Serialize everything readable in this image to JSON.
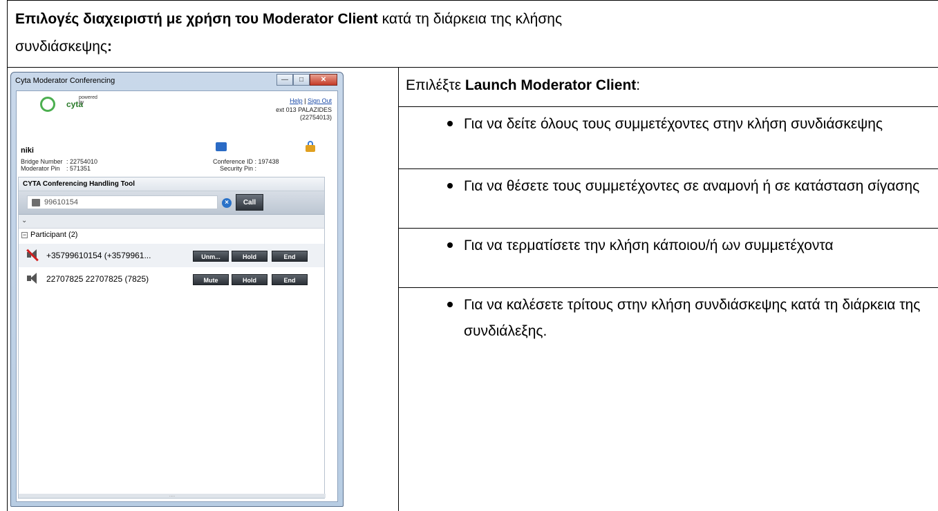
{
  "doc": {
    "header_bold": "Επιλογές διαχειριστή με χρήση του Moderator Client",
    "header_rest": " κατά τη διάρκεια της κλήσης",
    "header_line2": "συνδιάσκεψης",
    "header_colon": ":",
    "intro_prefix": "Επιλέξτε ",
    "intro_bold": "Launch Moderator Client",
    "intro_suffix": ":",
    "bullets": [
      "Για να δείτε όλους τους συμμετέχοντες στην κλήση συνδιάσκεψης",
      "Για να θέσετε τους συμμετέχοντες σε αναμονή ή σε κατάσταση σίγασης",
      "Για να τερματίσετε την κλήση κάποιου/ή ων συμμετέχοντα",
      "Για να καλέσετε τρίτους στην κλήση συνδιάσκεψης κατά τη διάρκεια της συνδιάλεξης."
    ]
  },
  "app": {
    "window_title": "Cyta Moderator Conferencing",
    "powered_by": "powered by",
    "brand": "cyta",
    "help": "Help",
    "sep": "|",
    "sign_out": "Sign Out",
    "ext_line1": "ext 013 PALAZIDES",
    "ext_line2": "(22754013)",
    "user": "niki",
    "bridge_label": "Bridge Number",
    "bridge_value": ": 22754010",
    "mod_pin_label": "Moderator Pin",
    "mod_pin_value": ": 571351",
    "conf_id_label": "Conference ID",
    "conf_id_value": ": 197438",
    "sec_pin_label": "Security Pin",
    "sec_pin_value": ":",
    "tool_title": "CYTA Conferencing Handling Tool",
    "dial_value": "99610154",
    "call_label": "Call",
    "collapse_glyph": "⌄",
    "group_label": "Participant (2)",
    "participants": [
      {
        "name": "+35799610154 (+3579961...",
        "b1": "Unm...",
        "b2": "Hold",
        "b3": "End"
      },
      {
        "name": "22707825 22707825 (7825)",
        "b1": "Mute",
        "b2": "Hold",
        "b3": "End"
      }
    ],
    "grip": "....."
  }
}
